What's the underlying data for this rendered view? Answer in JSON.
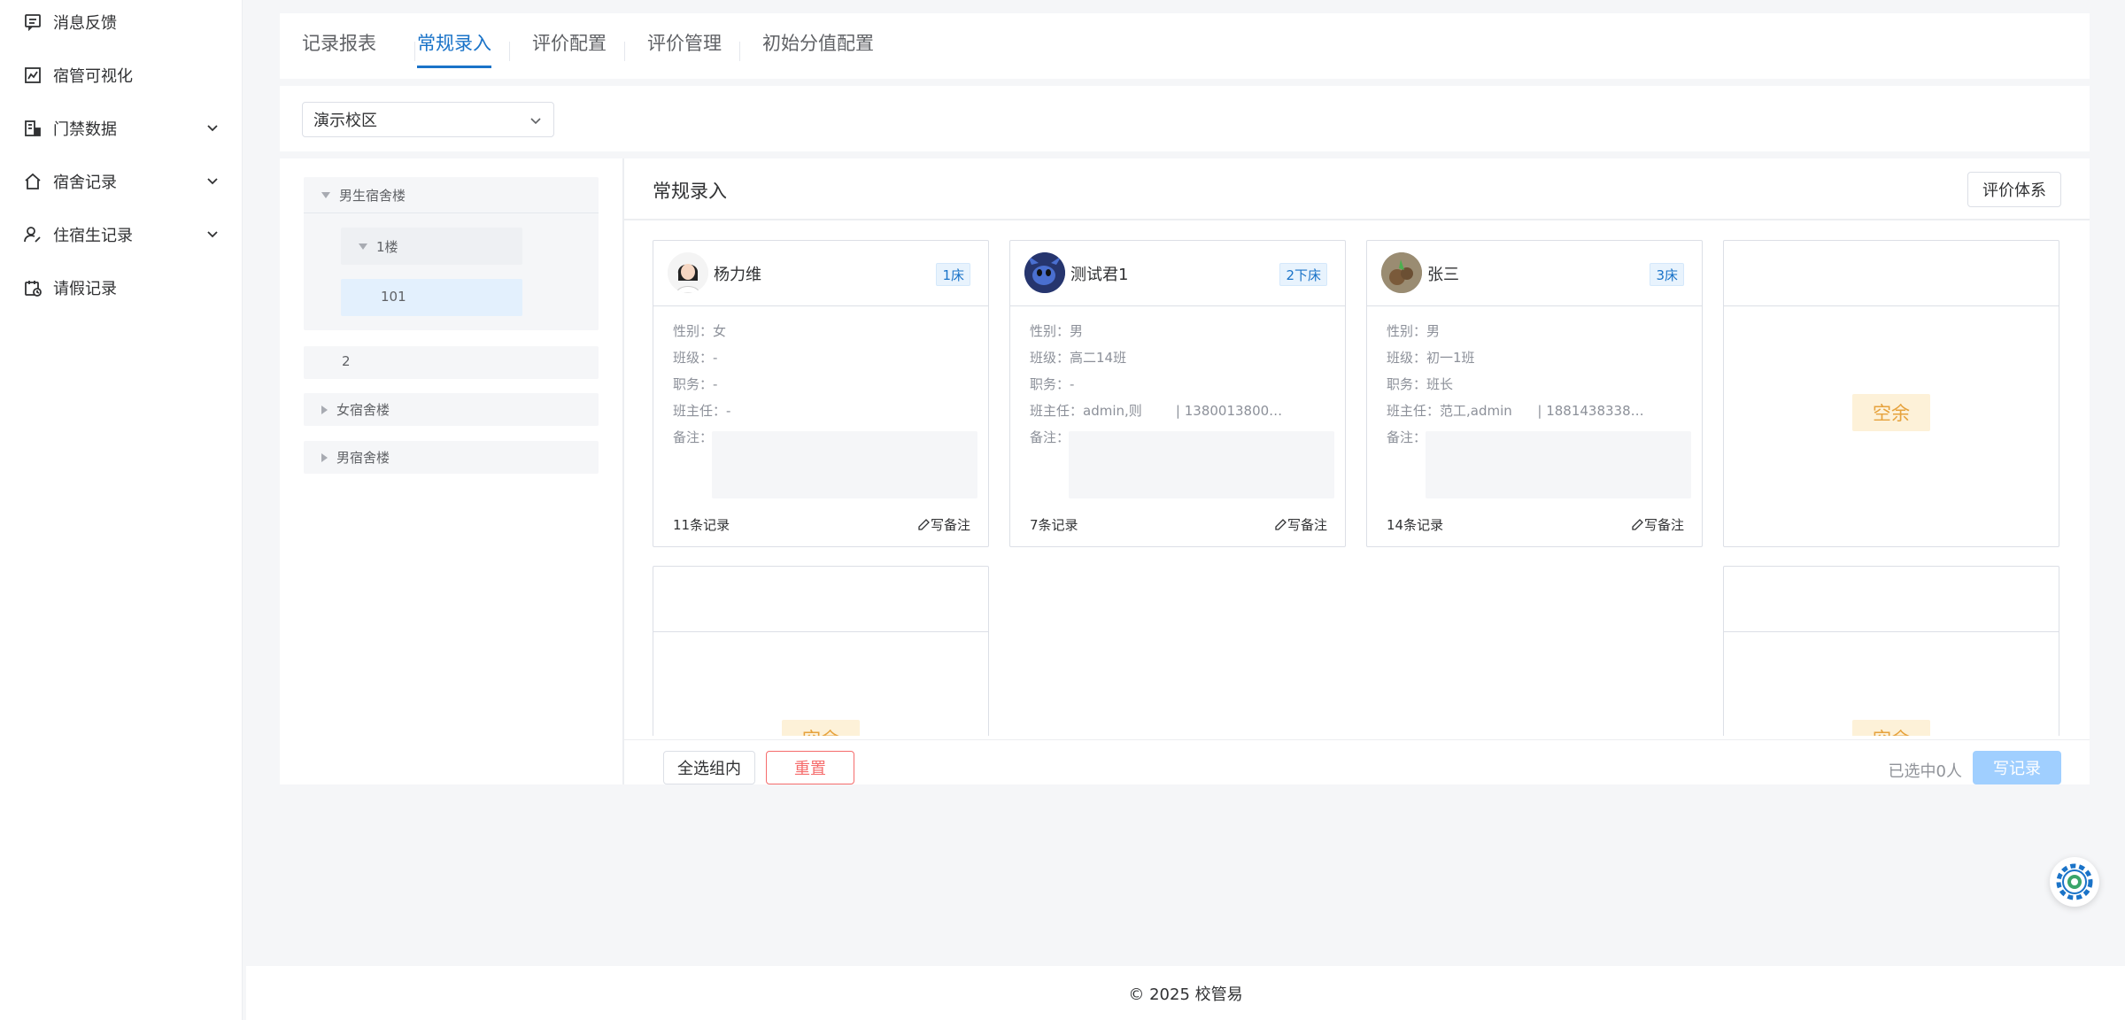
{
  "sidebar": {
    "items": [
      {
        "label": "消息反馈",
        "icon": "message-icon",
        "expandable": false
      },
      {
        "label": "宿管可视化",
        "icon": "chart-icon",
        "expandable": false
      },
      {
        "label": "门禁数据",
        "icon": "building-icon",
        "expandable": true
      },
      {
        "label": "宿舍记录",
        "icon": "home-icon",
        "expandable": true
      },
      {
        "label": "住宿生记录",
        "icon": "user-edit-icon",
        "expandable": true
      },
      {
        "label": "请假记录",
        "icon": "calendar-icon",
        "expandable": false
      }
    ]
  },
  "tabs": [
    {
      "label": "记录报表",
      "active": false
    },
    {
      "label": "常规录入",
      "active": true
    },
    {
      "label": "评价配置",
      "active": false
    },
    {
      "label": "评价管理",
      "active": false
    },
    {
      "label": "初始分值配置",
      "active": false
    }
  ],
  "campus_select": {
    "value": "演示校区"
  },
  "tree": {
    "groups": [
      {
        "label": "男生宿舍楼",
        "expanded": true,
        "floor": "1楼",
        "room": "101"
      },
      {
        "label": "2"
      },
      {
        "label": "女宿舍楼",
        "expanded": false
      },
      {
        "label": "男宿舍楼",
        "expanded": false
      }
    ]
  },
  "panel": {
    "title": "常规录入",
    "eval_button": "评价体系"
  },
  "labels": {
    "gender": "性别：",
    "class": "班级：",
    "duty": "职务：",
    "teacher": "班主任：",
    "remark": "备注：",
    "write_note": "写备注",
    "empty": "空余"
  },
  "students": [
    {
      "name": "杨力维",
      "bed": "1床",
      "gender": "女",
      "class": "-",
      "duty": "-",
      "teacher": "-",
      "records": "11条记录",
      "avatar": "female-avatar"
    },
    {
      "name": "测试君1",
      "bed": "2下床",
      "gender": "男",
      "class": "高二14班",
      "duty": "-",
      "teacher": "admin,则        | 1380013800…",
      "records": "7条记录",
      "avatar": "stitch-avatar"
    },
    {
      "name": "张三",
      "bed": "3床",
      "gender": "男",
      "class": "初一1班",
      "duty": "班长",
      "teacher": "范工,admin      | 1881438338…",
      "records": "14条记录",
      "avatar": "photo-avatar"
    }
  ],
  "bottom": {
    "select_all": "全选组内",
    "reset": "重置",
    "selected": "已选中0人",
    "write_record": "写记录"
  },
  "footer": {
    "text": "© 2025 校管易"
  },
  "colors": {
    "primary": "#1a73c8",
    "danger": "#f56c6c",
    "warning": "#e6a23c",
    "disabled_primary": "#a0cfff"
  }
}
